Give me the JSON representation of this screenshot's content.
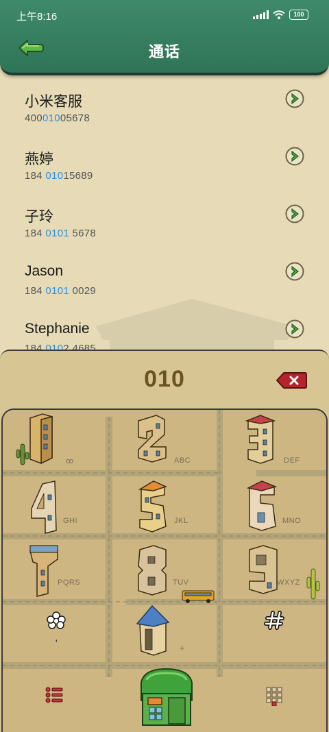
{
  "status": {
    "time": "上午8:16",
    "battery": "100"
  },
  "header": {
    "title": "通话"
  },
  "contacts": [
    {
      "name": "小米客服",
      "num_pre": "400",
      "num_hl": "010",
      "num_post": "05678"
    },
    {
      "name": "燕婷",
      "num_pre": "184 ",
      "num_hl": "010",
      "num_post": "15689"
    },
    {
      "name": "子玲",
      "num_pre": "184 ",
      "num_hl": "0101",
      "num_post": " 5678"
    },
    {
      "name": "Jason",
      "num_pre": "184 ",
      "num_hl": "0101",
      "num_post": " 0029"
    },
    {
      "name": "Stephanie",
      "num_pre": "184 ",
      "num_hl": "010",
      "num_post": "2 4685"
    }
  ],
  "dialer": {
    "digits": "010"
  },
  "keys": [
    {
      "digit": "1",
      "letters": "ꝏ"
    },
    {
      "digit": "2",
      "letters": "ABC"
    },
    {
      "digit": "3",
      "letters": "DEF"
    },
    {
      "digit": "4",
      "letters": "GHI"
    },
    {
      "digit": "5",
      "letters": "JKL"
    },
    {
      "digit": "6",
      "letters": "MNO"
    },
    {
      "digit": "7",
      "letters": "PQRS"
    },
    {
      "digit": "8",
      "letters": "TUV"
    },
    {
      "digit": "9",
      "letters": "WXYZ"
    },
    {
      "digit": "*",
      "letters": ","
    },
    {
      "digit": "0",
      "letters": "+"
    },
    {
      "digit": "#",
      "letters": ""
    }
  ],
  "colors": {
    "accent": "#2d8fe0",
    "header_green": "#3a8566",
    "delete_red": "#b5232b"
  }
}
